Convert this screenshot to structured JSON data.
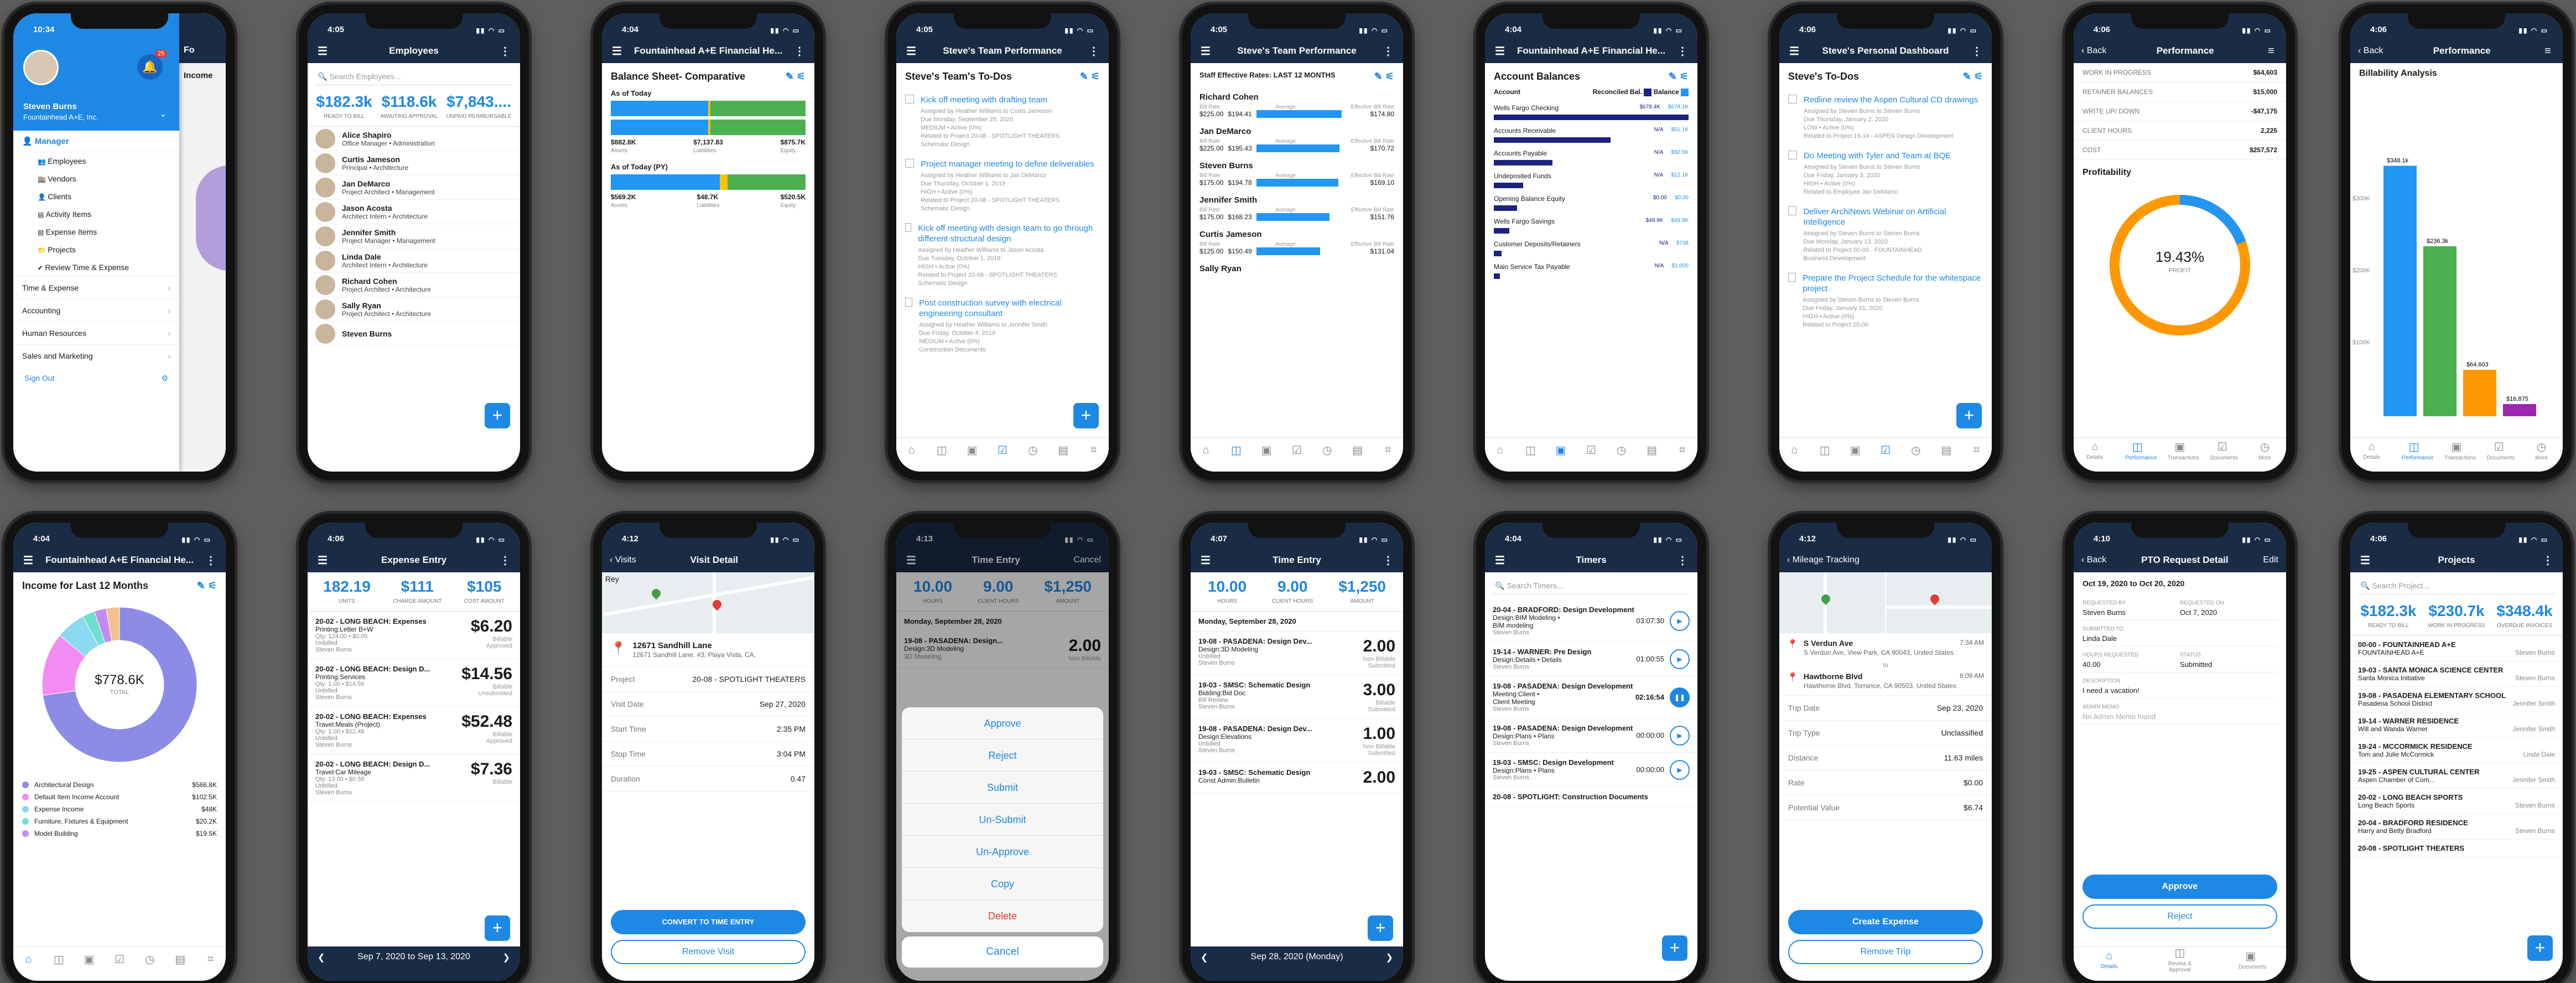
{
  "p1": {
    "time": "10:34",
    "user_name": "Steven Burns",
    "company": "Fountainhead A+E, Inc.",
    "badge": "25",
    "manager": "Manager",
    "items": [
      "Employees",
      "Vendors",
      "Clients",
      "Activity Items",
      "Expense Items",
      "Projects",
      "Review Time & Expense"
    ],
    "groups": [
      "Time & Expense",
      "Accounting",
      "Human Resources",
      "Sales and Marketing"
    ],
    "sign_out": "Sign Out",
    "peek_title": "Fo",
    "peek_income": "Income"
  },
  "p2": {
    "time": "4:05",
    "title": "Employees",
    "search": "Search Employees...",
    "stats": [
      {
        "v": "$182.3k",
        "l": "READY TO BILL"
      },
      {
        "v": "$118.6k",
        "l": "AWAITING APPROVAL"
      },
      {
        "v": "$7,843....",
        "l": "UNPAID REIMBURSABLE"
      }
    ],
    "employees": [
      {
        "n": "Alice Shapiro",
        "r": "Office Manager • Administration"
      },
      {
        "n": "Curtis Jameson",
        "r": "Principal • Architecture"
      },
      {
        "n": "Jan DeMarco",
        "r": "Project Architect • Management"
      },
      {
        "n": "Jason Acosta",
        "r": "Architect Intern • Architecture"
      },
      {
        "n": "Jennifer Smith",
        "r": "Project Manager • Management"
      },
      {
        "n": "Linda Dale",
        "r": "Architect Intern • Architecture"
      },
      {
        "n": "Richard Cohen",
        "r": "Project Architect • Architecture"
      },
      {
        "n": "Sally Ryan",
        "r": "Project Architect • Architecture"
      },
      {
        "n": "Steven Burns",
        "r": ""
      }
    ]
  },
  "p3": {
    "time": "4:04",
    "title": "Fountainhead A+E Financial He...",
    "heading": "Balance Sheet- Comparative",
    "today": "As of Today",
    "prior": "As of Today (PY)",
    "v1": [
      {
        "v": "$882.8K",
        "l": "Assets"
      },
      {
        "v": "$7,137.83",
        "l": "Liabilities"
      },
      {
        "v": "$875.7K",
        "l": "Equity"
      }
    ],
    "v2": [
      {
        "v": "$569.2K",
        "l": "Assets"
      },
      {
        "v": "$48.7K",
        "l": "Liabilities"
      },
      {
        "v": "$520.5K",
        "l": "Equity"
      }
    ]
  },
  "p4": {
    "time": "4:05",
    "title": "Steve's Team Performance",
    "heading": "Steve's Team's To-Dos",
    "todos": [
      {
        "t": "Kick off meeting with drafting team",
        "d": "Assigned by Heather Williams to Curtis Jameson\nDue Monday, September 28, 2020\nMEDIUM • Active (0%)\nRelated to Project 20-08 - SPOTLIGHT THEATERS\nSchematic Design"
      },
      {
        "t": "Project manager meeting to define deliverables",
        "d": "Assigned by Heather Williams to Jan DeMarco\nDue Thursday, October 1, 2019\nHIGH • Active (0%)\nRelated to Project 20-08 - SPOTLIGHT THEATERS\nSchematic Design"
      },
      {
        "t": "Kick off meeting with design team to go through different structural design",
        "d": "Assigned by Heather Williams to Jason Acosta\nDue Tuesday, October 1, 2019\nHIGH • Active (0%)\nRelated to Project 20-08 - SPOTLIGHT THEATERS\nSchematic Design"
      },
      {
        "t": "Post construction survey with electrical engineering consultant",
        "d": "Assigned by Heather Williams to Jennifer Smith\nDue Friday, October 4, 2019\nMEDIUM • Active (0%)\nConstruction Documents"
      }
    ]
  },
  "p5": {
    "time": "4:05",
    "title": "Steve's Team Performance",
    "heading": "Staff Effective Rates: LAST 12 MONTHS",
    "staff": [
      {
        "n": "Richard Cohen",
        "b": "$225.00",
        "a": "$194.41",
        "e": "$174.80",
        "f": 0.78
      },
      {
        "n": "Jan DeMarco",
        "b": "$225.00",
        "a": "$195.43",
        "e": "$170.72",
        "f": 0.76
      },
      {
        "n": "Steven Burns",
        "b": "$175.00",
        "a": "$194.78",
        "e": "$169.10",
        "f": 0.75
      },
      {
        "n": "Jennifer Smith",
        "b": "$175.00",
        "a": "$168.23",
        "e": "$151.76",
        "f": 0.67
      },
      {
        "n": "Curtis Jameson",
        "b": "$125.00",
        "a": "$150.49",
        "e": "$131.04",
        "f": 0.58
      },
      {
        "n": "Sally Ryan",
        "b": "",
        "a": "",
        "e": "",
        "f": 0
      }
    ],
    "lbl_bill": "Bill Rate",
    "lbl_avg": "Average",
    "lbl_eff": "Effective Bill Rate"
  },
  "p6": {
    "time": "4:04",
    "title": "Fountainhead A+E Financial He...",
    "heading": "Account Balances",
    "col1": "Account",
    "col2": "Reconciled Bal.",
    "col3": "Balance",
    "accounts": [
      {
        "n": "Wells Fargo Checking",
        "r": "$678.4K",
        "b": "$678.1K",
        "f": 1.0
      },
      {
        "n": "Accounts Receivable",
        "r": "N/A",
        "b": "$51.1K",
        "f": 0.6
      },
      {
        "n": "Accounts Payable",
        "r": "N/A",
        "b": "$92.5K",
        "f": 0.3
      },
      {
        "n": "Undeposited Funds",
        "r": "N/A",
        "b": "$12.1K",
        "f": 0.15
      },
      {
        "n": "Opening Balance Equity",
        "r": "$0.00",
        "b": "$0.00",
        "f": 0.12
      },
      {
        "n": "Wells Fargo Savings",
        "r": "$49.9K",
        "b": "$49.9K",
        "f": 0.08
      },
      {
        "n": "Customer Deposits/Retainers",
        "r": "N/A",
        "b": "$738",
        "f": 0.04
      },
      {
        "n": "Main Service Tax Payable",
        "r": "N/A",
        "b": "$1,000",
        "f": 0.03
      }
    ]
  },
  "p7": {
    "time": "4:06",
    "title": "Steve's Personal Dashboard",
    "heading": "Steve's To-Dos",
    "todos": [
      {
        "t": "Redline review the Aspen Cultural CD drawings",
        "d": "Assigned by Steven Burns to Steven Burns\nDue Thursday, January 2, 2020\nLOW • Active (0%)\nRelated to Project 19-14 - ASPEN Design Development"
      },
      {
        "t": "Do Meeting with Tyler and Team at BQE",
        "d": "Assigned by Steven Burns to Steven Burns\nDue Friday, January 3, 2020\nHIGH • Active (0%)\nRelated to Employee Jan DeMarco"
      },
      {
        "t": "Deliver ArchiNews Webinar on Artificial Intelligence",
        "d": "Assigned by Steven Burns to Steven Burns\nDue Monday, January 13, 2020\nRelated to Project 00-00 - FOUNTAINHEAD\nBusiness Development"
      },
      {
        "t": "Prepare the Project Schedule for the whitespace project",
        "d": "Assigned by Steven Burns to Steven Burns\nDue Friday, January 31, 2020\nHIGH • Active (0%)\nRelated to Project 20-06"
      }
    ]
  },
  "p8": {
    "time": "4:06",
    "back": "Back",
    "title": "Performance",
    "kv": [
      {
        "k": "WORK IN PROGRESS",
        "v": "$64,603"
      },
      {
        "k": "RETAINER BALANCES",
        "v": "$15,000"
      },
      {
        "k": "WRITE UP/ DOWN",
        "v": "-$47,175"
      },
      {
        "k": "CLIENT HOURS",
        "v": "2,225"
      },
      {
        "k": "COST",
        "v": "$257,572"
      }
    ],
    "prof": "Profitability",
    "pct": "19.43%",
    "pct_lbl": "PROFIT",
    "tabs": [
      "Details",
      "Performance",
      "Transactions",
      "Documents",
      "More"
    ]
  },
  "p9": {
    "time": "4:06",
    "back": "Back",
    "title": "Performance",
    "heading": "Billability Analysis",
    "bars": [
      {
        "v": "$348.1k",
        "val": 348.1,
        "c": "#2196f3"
      },
      {
        "v": "$236.3k",
        "val": 236.3,
        "c": "#4caf50"
      },
      {
        "v": "$64,603",
        "val": 64.6,
        "c": "#ff9800"
      },
      {
        "v": "$16,875",
        "val": 16.9,
        "c": "#9c27b0"
      }
    ],
    "ticks": [
      "$300K",
      "$200K",
      "$100K"
    ],
    "tabs": [
      "Details",
      "Performance",
      "Transactions",
      "Documents",
      "More"
    ]
  },
  "p10": {
    "time": "4:04",
    "title": "Fountainhead A+E Financial He...",
    "heading": "Income for Last 12 Months",
    "total": "$778.6K",
    "total_lbl": "TOTAL",
    "legend": [
      {
        "n": "Architectural Design",
        "v": "$566.8K",
        "c": "#8c8ce6"
      },
      {
        "n": "Default Item Income Account",
        "v": "$102.5K",
        "c": "#f28cf2"
      },
      {
        "n": "Expense Income",
        "v": "$48K",
        "c": "#8cd9f2"
      },
      {
        "n": "Furniture, Fixtures & Equipment",
        "v": "$20.2K",
        "c": "#6fe0d0"
      },
      {
        "n": "Model Building",
        "v": "$19.5K",
        "c": "#c08cf2"
      }
    ],
    "pie": [
      566.8,
      102.5,
      48,
      20.2,
      19.5,
      21.6
    ]
  },
  "p11": {
    "time": "4:06",
    "title": "Expense Entry",
    "stats": [
      {
        "v": "182.19",
        "l": "UNITS"
      },
      {
        "v": "$111",
        "l": "CHARGE AMOUNT"
      },
      {
        "v": "$105",
        "l": "COST AMOUNT"
      }
    ],
    "rows": [
      {
        "p": "20-02 - LONG BEACH: Expenses",
        "i": "Printing:Letter B+W",
        "q": "Qty: 124.00 • $0.05",
        "u": "Unbilled",
        "who": "Steven Burns",
        "a": "$6.20",
        "s": "Billable",
        "st": "Approved"
      },
      {
        "p": "20-02 - LONG BEACH: Design D...",
        "i": "Printing:Services",
        "q": "Qty: 1.00 • $14.56",
        "u": "Unbilled",
        "who": "Steven Burns",
        "a": "$14.56",
        "s": "Billable",
        "st": "Unsubmitted"
      },
      {
        "p": "20-02 - LONG BEACH: Expenses",
        "i": "Travel:Meals (Project)",
        "q": "Qty: 1.00 • $52.48",
        "u": "Unbilled",
        "who": "Steven Burns",
        "a": "$52.48",
        "s": "Billable",
        "st": "Approved"
      },
      {
        "p": "20-02 - LONG BEACH: Design D...",
        "i": "Travel:Car Mileage",
        "q": "Qty: 13.00 • $0.58",
        "u": "Unbilled",
        "who": "Steven Burns",
        "a": "$7.36",
        "s": "Billable",
        "st": ""
      }
    ],
    "week": "Sep 7, 2020 to Sep 13, 2020"
  },
  "p12": {
    "time": "4:12",
    "back": "Visits",
    "title": "Visit Detail",
    "map_lbl": "Rey",
    "addr1": "12671 Sandhill Lane",
    "addr2": "12671 Sandhill Lane, #3, Playa Vista, CA,",
    "kv": [
      {
        "k": "Project",
        "v": "20-08 - SPOTLIGHT THEATERS"
      },
      {
        "k": "Visit Date",
        "v": "Sep 27, 2020"
      },
      {
        "k": "Start Time",
        "v": "2:35 PM"
      },
      {
        "k": "Stop Time",
        "v": "3:04 PM"
      },
      {
        "k": "Duration",
        "v": "0.47"
      }
    ],
    "btn1": "CONVERT TO TIME ENTRY",
    "btn2": "Remove Visit"
  },
  "p13": {
    "time": "4:13",
    "title": "Time Entry",
    "cancel": "Cancel",
    "stats": [
      {
        "v": "10.00",
        "l": "HOURS"
      },
      {
        "v": "9.00",
        "l": "CLIENT HOURS"
      },
      {
        "v": "$1,250",
        "l": "AMOUNT"
      }
    ],
    "date": "Monday, September 28, 2020",
    "entry": {
      "p": "19-08 - PASADENA: Design...",
      "i": "Design:3D Modeling",
      "s": "3D Modeling",
      "h": "2.00",
      "b": "Non Billable"
    },
    "actions": [
      "Approve",
      "Reject",
      "Submit",
      "Un-Submit",
      "Un-Approve",
      "Copy",
      "Delete"
    ],
    "cancel_btn": "Cancel"
  },
  "p14": {
    "time": "4:07",
    "title": "Time Entry",
    "stats": [
      {
        "v": "10.00",
        "l": "HOURS"
      },
      {
        "v": "9.00",
        "l": "CLIENT HOURS"
      },
      {
        "v": "$1,250",
        "l": "AMOUNT"
      }
    ],
    "date": "Monday, September 28, 2020",
    "rows": [
      {
        "p": "19-08 - PASADENA: Design Dev...",
        "i": "Design:3D Modeling",
        "u": "Unbilled",
        "who": "Steven Burns",
        "h": "2.00",
        "b": "Non Billable",
        "s": "Submitted"
      },
      {
        "p": "19-03 - SMSC: Schematic Design",
        "i": "Bidding:Bid Doc",
        "u": "Bill Review",
        "who": "Steven Burns",
        "h": "3.00",
        "b": "Billable",
        "s": "Submitted"
      },
      {
        "p": "19-08 - PASADENA: Design Dev...",
        "i": "Design:Elevations",
        "u": "Unbilled",
        "who": "Steven Burns",
        "h": "1.00",
        "b": "Non Billable",
        "s": "Submitted"
      },
      {
        "p": "19-03 - SMSC: Schematic Design",
        "i": "Const Admin:Bulletin",
        "u": "",
        "who": "",
        "h": "2.00",
        "b": "",
        "s": ""
      }
    ],
    "day": "Sep 28, 2020 (Monday)"
  },
  "p15": {
    "time": "4:04",
    "title": "Timers",
    "search": "Search Timers...",
    "rows": [
      {
        "p": "20-04 - BRADFORD: Design Development",
        "i": "Design:BIM Modeling •",
        "s": "BIM modeling",
        "who": "Steven Burns",
        "t": "03:07:30",
        "on": false
      },
      {
        "p": "19-14 - WARNER: Pre Design",
        "i": "Design:Details • Details",
        "s": "",
        "who": "Steven Burns",
        "t": "01:00:55",
        "on": false
      },
      {
        "p": "19-08 - PASADENA: Design Development",
        "i": "Meeting:Client •",
        "s": "Client Meeting",
        "who": "Steven Burns",
        "t": "02:16:54",
        "on": true
      },
      {
        "p": "19-08 - PASADENA: Design Development",
        "i": "Design:Plans • Plans",
        "s": "",
        "who": "Steven Burns",
        "t": "00:00:00",
        "on": false
      },
      {
        "p": "19-03 - SMSC: Design Development",
        "i": "Design:Plans • Plans",
        "s": "",
        "who": "Steven Burns",
        "t": "00:00:00",
        "on": false
      },
      {
        "p": "20-08 - SPOTLIGHT: Construction Documents",
        "i": "",
        "s": "",
        "who": "",
        "t": "",
        "on": false
      }
    ]
  },
  "p16": {
    "time": "4:12",
    "back": "Mileage Tracking",
    "from": {
      "n": "S Verdun Ave",
      "a": "S Verdun Ave, View Park, CA 90043, United States",
      "t": "7:34 AM"
    },
    "to_lbl": "to",
    "to": {
      "n": "Hawthorne Blvd",
      "a": "Hawthorne Blvd, Torrance, CA 90503, United States",
      "t": "8:09 AM"
    },
    "kv": [
      {
        "k": "Trip Date",
        "v": "Sep 23, 2020"
      },
      {
        "k": "Trip Type",
        "v": "Unclassified"
      },
      {
        "k": "Distance",
        "v": "11.63 miles"
      },
      {
        "k": "Rate",
        "v": "$0.00"
      },
      {
        "k": "Potential Value",
        "v": "$6.74"
      }
    ],
    "btn1": "Create Expense",
    "btn2": "Remove Trip"
  },
  "p17": {
    "time": "4:10",
    "back": "Back",
    "title": "PTO Request Detail",
    "edit": "Edit",
    "range": "Oct 19, 2020 to Oct 20, 2020",
    "fields": [
      {
        "k": "REQUESTED BY",
        "v": "Steven Burns"
      },
      {
        "k": "REQUESTED ON",
        "v": "Oct 7, 2020"
      },
      {
        "k": "SUBMITTED TO",
        "v": "Linda Dale"
      },
      {
        "k": "HOURS REQUESTED",
        "v": "40.00"
      },
      {
        "k": "STATUS",
        "v": "Submitted"
      },
      {
        "k": "DESCRIPTION",
        "v": "I need a vacation!"
      },
      {
        "k": "ADMIN MEMO",
        "v": "No Admin Memo found"
      }
    ],
    "approve": "Approve",
    "reject": "Reject",
    "tabs": [
      "Details",
      "Review & Approval",
      "Documents"
    ]
  },
  "p18": {
    "time": "4:06",
    "title": "Projects",
    "search": "Search Project...",
    "stats": [
      {
        "v": "$182.3k",
        "l": "READY TO BILL"
      },
      {
        "v": "$230.7k",
        "l": "WORK IN PROGRESS"
      },
      {
        "v": "$348.4k",
        "l": "OVERDUE INVOICES"
      }
    ],
    "projects": [
      {
        "n": "00-00 - FOUNTAINHEAD A+E",
        "c": "FOUNTAINHEAD A+E",
        "m": "Steven Burns"
      },
      {
        "n": "19-03 - SANTA MONICA SCIENCE CENTER",
        "c": "Santa Monica Initiative",
        "m": "Steven Burns"
      },
      {
        "n": "19-08 - PASADENA ELEMENTARY SCHOOL",
        "c": "Pasadena School District",
        "m": "Jennifer Smith"
      },
      {
        "n": "19-14 - WARNER RESIDENCE",
        "c": "Will and Wanda Warner",
        "m": "Jennifer Smith"
      },
      {
        "n": "19-24 - MCCORMICK RESIDENCE",
        "c": "Tom and Julie McCormick",
        "m": "Linda Dale"
      },
      {
        "n": "19-25 - ASPEN CULTURAL CENTER",
        "c": "Aspen Chamber of Com...",
        "m": "Jennifer Smith"
      },
      {
        "n": "20-02 - LONG BEACH SPORTS",
        "c": "Long Beach Sports",
        "m": "Steven Burns"
      },
      {
        "n": "20-04 - BRADFORD RESIDENCE",
        "c": "Harry and Betty Bradford",
        "m": "Steven Burns"
      },
      {
        "n": "20-08 - SPOTLIGHT THEATERS",
        "c": "",
        "m": ""
      }
    ]
  }
}
